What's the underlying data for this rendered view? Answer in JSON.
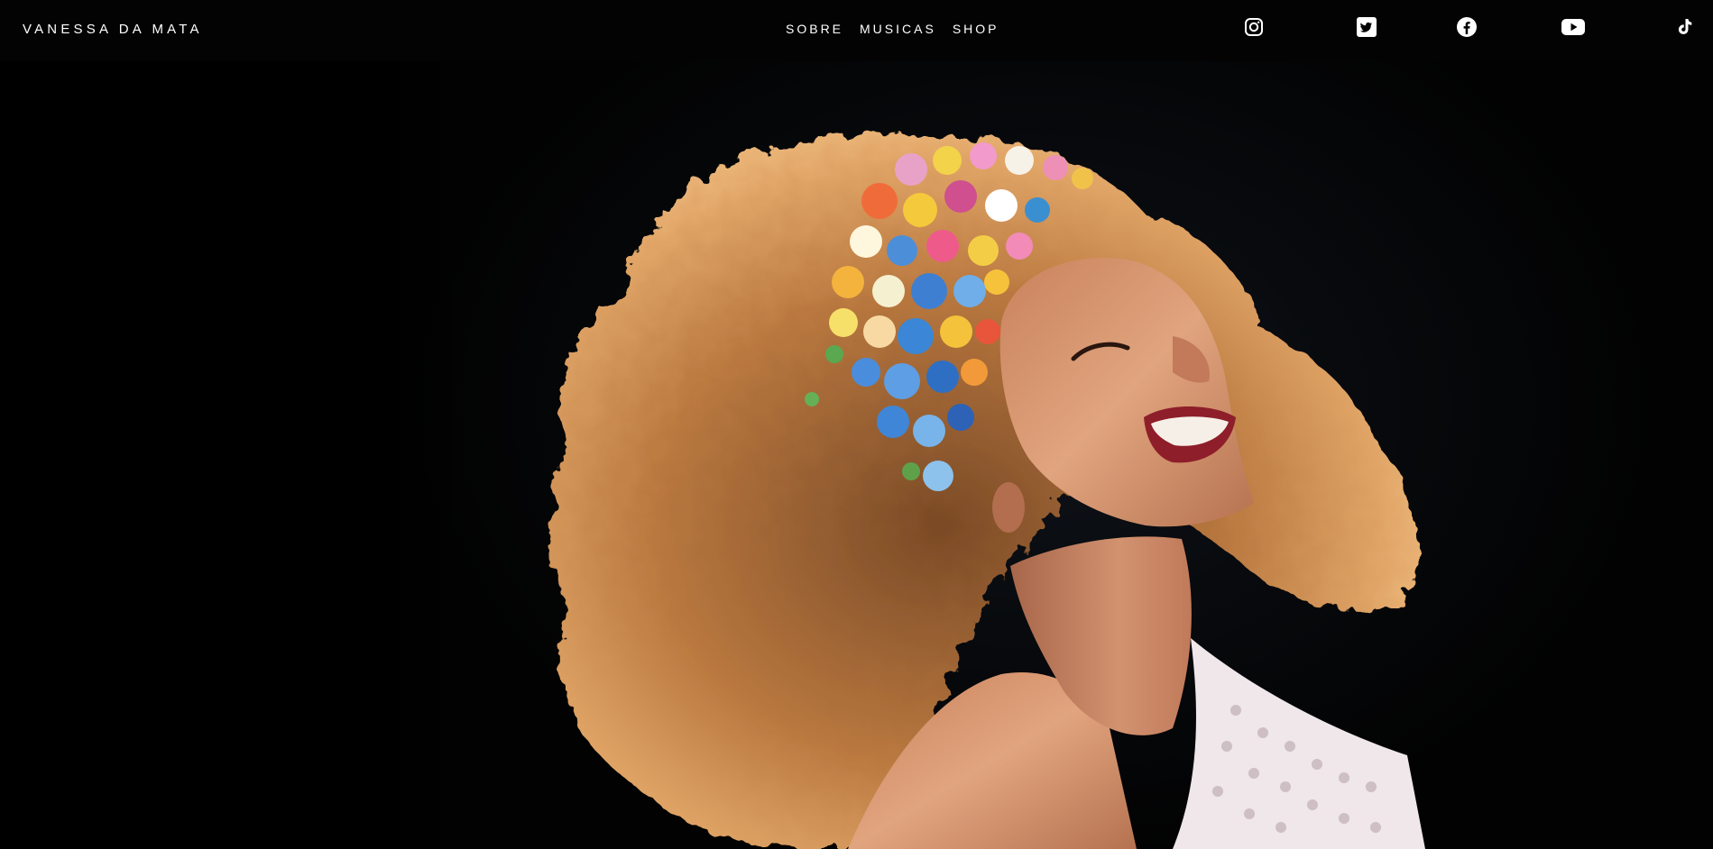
{
  "header": {
    "brand": "VANESSA DA MATA",
    "nav": [
      {
        "label": "SOBRE"
      },
      {
        "label": "MUSICAS"
      },
      {
        "label": "SHOP"
      }
    ],
    "social_icons": [
      "instagram-icon",
      "twitter-icon",
      "facebook-icon",
      "youtube-icon",
      "tiktok-icon"
    ]
  },
  "hero": {
    "image": "portrait-photo",
    "colors": {
      "hair": "#c98a4c",
      "skin": "#d99a74",
      "background": "#05070a"
    }
  }
}
